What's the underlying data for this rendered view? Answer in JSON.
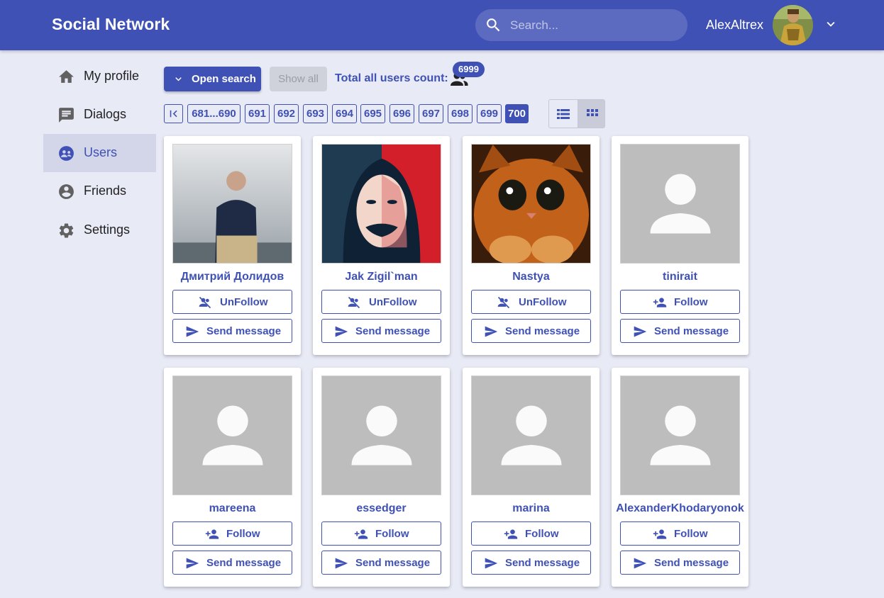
{
  "header": {
    "brand": "Social Network",
    "search_placeholder": "Search...",
    "username": "AlexAltrex"
  },
  "sidebar": {
    "items": [
      {
        "label": "My profile",
        "icon": "home-icon"
      },
      {
        "label": "Dialogs",
        "icon": "chat-icon"
      },
      {
        "label": "Users",
        "icon": "users-icon",
        "active": true
      },
      {
        "label": "Friends",
        "icon": "account-circle-icon"
      },
      {
        "label": "Settings",
        "icon": "gear-icon"
      }
    ]
  },
  "toolbar": {
    "open_search_label": "Open search",
    "show_all_label": "Show all",
    "total_label": "Total all users count:",
    "total_count": "6999"
  },
  "pagination": {
    "range_label": "681...690",
    "pages": [
      "691",
      "692",
      "693",
      "694",
      "695",
      "696",
      "697",
      "698",
      "699",
      "700"
    ],
    "active_page": "700"
  },
  "colors": {
    "primary": "#3f51b5",
    "background": "#e8eaf6",
    "placeholder_gray": "#bdbdbd"
  },
  "users": [
    {
      "name": "Дмитрий Долидов",
      "follow_label": "UnFollow",
      "message_label": "Send message",
      "photo": "person-photo"
    },
    {
      "name": "Jak Zigil`man",
      "follow_label": "UnFollow",
      "message_label": "Send message",
      "photo": "mask-photo"
    },
    {
      "name": "Nastya",
      "follow_label": "UnFollow",
      "message_label": "Send message",
      "photo": "cat-photo"
    },
    {
      "name": "tinirait",
      "follow_label": "Follow",
      "message_label": "Send message",
      "photo": "default-avatar"
    },
    {
      "name": "mareena",
      "follow_label": "Follow",
      "message_label": "Send message",
      "photo": "default-avatar"
    },
    {
      "name": "essedger",
      "follow_label": "Follow",
      "message_label": "Send message",
      "photo": "default-avatar"
    },
    {
      "name": "marina",
      "follow_label": "Follow",
      "message_label": "Send message",
      "photo": "default-avatar"
    },
    {
      "name": "AlexanderKhodaryonok",
      "follow_label": "Follow",
      "message_label": "Send message",
      "photo": "default-avatar"
    }
  ]
}
